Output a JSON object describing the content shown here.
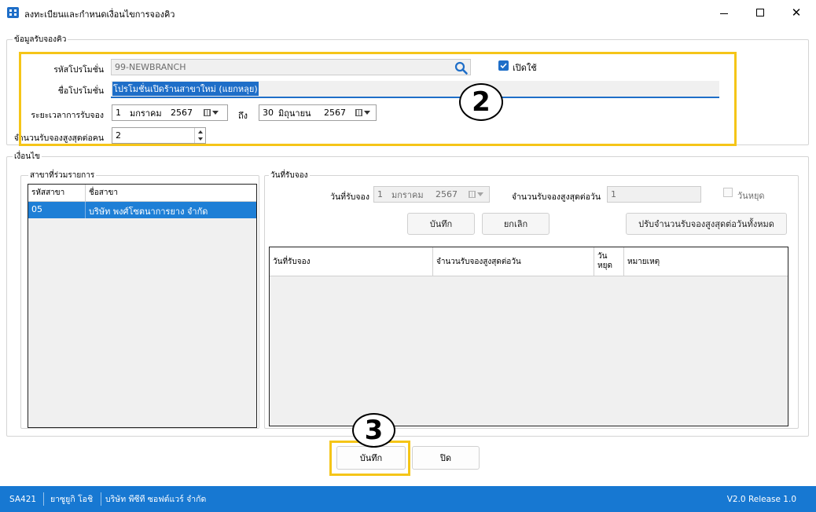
{
  "window": {
    "title": "ลงทะเบียนและกำหนดเงื่อนไขการจองคิว",
    "minimize_icon": "minimize-icon",
    "maximize_icon": "maximize-icon",
    "close_glyph": "✕"
  },
  "booking_info": {
    "legend": "ข้อมูลรับจองคิว",
    "promo_code_label": "รหัสโปรโมชั่น",
    "promo_code_value": "99-NEWBRANCH",
    "open_label": "เปิดใช้",
    "open_checked": true,
    "promo_name_label": "ชื่อโปรโมชั่น",
    "promo_name_value": "โปรโมชั่นเปิดร้านสาขาใหม่ (แยกหลุย)",
    "period_label": "ระยะเวลาการรับจอง",
    "date_from": {
      "day": "1",
      "month": "มกราคม",
      "year": "2567"
    },
    "to_label": "ถึง",
    "date_to": {
      "day": "30",
      "month": "มิถุนายน",
      "year": "2567"
    },
    "max_per_person_label": "จำนวนรับจองสูงสุดต่อคน",
    "max_per_person_value": "2"
  },
  "conditions": {
    "legend": "เงื่อนไข",
    "branches_legend": "สาขาที่ร่วมรายการ",
    "branch_columns": [
      "รหัสสาขา",
      "ชื่อสาขา"
    ],
    "branch_rows": [
      {
        "code": "05",
        "name": "บริษัท พงศ์โซตนาการยาง จำกัด"
      }
    ],
    "booking_days_legend": "วันที่รับจอง",
    "booking_date_label": "วันที่รับจอง",
    "booking_date": {
      "day": "1",
      "month": "มกราคม",
      "year": "2567"
    },
    "max_per_day_label": "จำนวนรับจองสูงสุดต่อวัน",
    "max_per_day_value": "1",
    "holiday_label": "วันหยุด",
    "save_label": "บันทึก",
    "cancel_label": "ยกเลิก",
    "adjust_all_label": "ปรับจำนวนรับจองสูงสุดต่อวันทั้งหมด",
    "day_columns": [
      "วันที่รับจอง",
      "จำนวนรับจองสูงสุดต่อวัน",
      "วัน\nหยุด",
      "หมายเหตุ"
    ]
  },
  "footer": {
    "save_label": "บันทึก",
    "close_label": "ปิด"
  },
  "annotations": {
    "step2": "2",
    "step3": "3",
    "highlight_color": "#f5c518"
  },
  "statusbar": {
    "code": "SA421",
    "user": "ยาซูยูกิ โอชิ",
    "company": "บริษัท พีซีที ซอฟต์แวร์ จำกัด",
    "version": "V2.0 Release 1.0",
    "color": "#1778d2"
  }
}
